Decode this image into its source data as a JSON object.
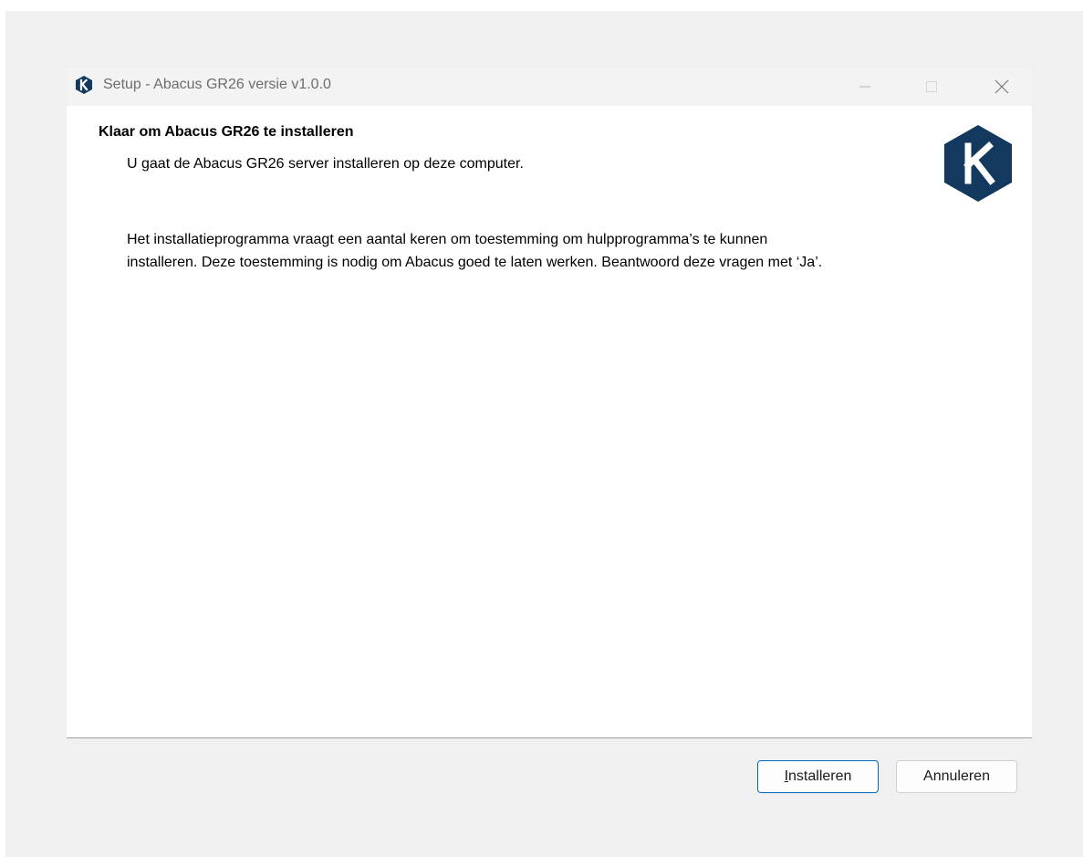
{
  "window": {
    "title": "Setup - Abacus GR26 versie v1.0.0",
    "app_icon": "k-hexagon-icon",
    "controls": {
      "minimize_icon": "minimize-icon",
      "maximize_icon": "maximize-icon",
      "close_icon": "close-icon"
    }
  },
  "header": {
    "title": "Klaar om Abacus GR26 te installeren",
    "subtitle": "U gaat de Abacus GR26 server installeren op deze computer.",
    "logo": "k-hexagon-logo"
  },
  "body": {
    "line1": "Het installatieprogramma vraagt een aantal keren om toestemming om hulpprogramma’s te kunnen",
    "line2": "installeren. Deze toestemming is nodig om Abacus goed te laten werken. Beantwoord deze vragen met ‘Ja’."
  },
  "buttons": {
    "install_accel": "I",
    "install_rest": "nstalleren",
    "cancel": "Annuleren"
  },
  "colors": {
    "logo_navy": "#133a5e",
    "primary_border": "#0067c0"
  }
}
